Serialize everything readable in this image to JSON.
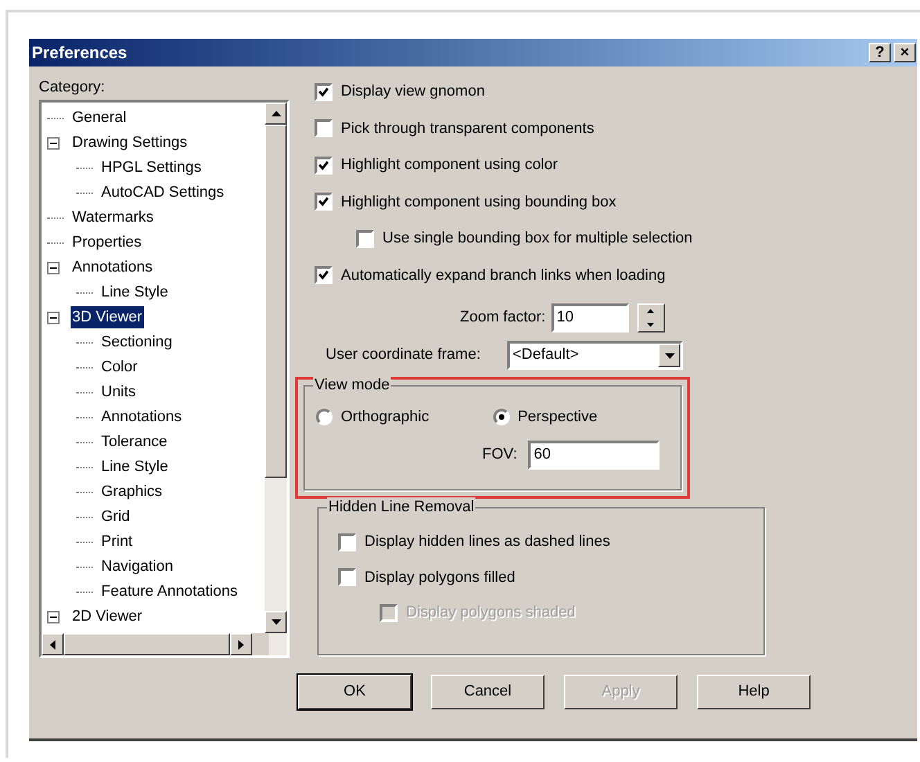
{
  "window": {
    "title": "Preferences",
    "buttons": [
      "?",
      "×"
    ]
  },
  "category": {
    "label": "Category:",
    "tree": [
      {
        "label": "General",
        "selected": false
      },
      {
        "label": "Drawing Settings",
        "selected": false,
        "expanded": true,
        "children": [
          {
            "label": "HPGL Settings",
            "selected": false
          },
          {
            "label": "AutoCAD Settings",
            "selected": false
          }
        ]
      },
      {
        "label": "Watermarks",
        "selected": false
      },
      {
        "label": "Properties",
        "selected": false
      },
      {
        "label": "Annotations",
        "selected": false,
        "expanded": true,
        "children": [
          {
            "label": "Line Style",
            "selected": false
          }
        ]
      },
      {
        "label": "3D Viewer",
        "selected": true,
        "expanded": true,
        "children": [
          {
            "label": "Sectioning",
            "selected": false
          },
          {
            "label": "Color",
            "selected": false
          },
          {
            "label": "Units",
            "selected": false
          },
          {
            "label": "Annotations",
            "selected": false
          },
          {
            "label": "Tolerance",
            "selected": false
          },
          {
            "label": "Line Style",
            "selected": false
          },
          {
            "label": "Graphics",
            "selected": false
          },
          {
            "label": "Grid",
            "selected": false
          },
          {
            "label": "Print",
            "selected": false
          },
          {
            "label": "Navigation",
            "selected": false
          },
          {
            "label": "Feature Annotations",
            "selected": false
          }
        ]
      },
      {
        "label": "2D Viewer",
        "selected": false,
        "expanded": true
      }
    ]
  },
  "options": [
    {
      "label": "Display view gnomon",
      "checked": true,
      "indented": false
    },
    {
      "label": "Pick through transparent components",
      "checked": false,
      "indented": false
    },
    {
      "label": "Highlight component using color",
      "checked": true,
      "indented": false
    },
    {
      "label": "Highlight component using bounding box",
      "checked": true,
      "indented": false
    },
    {
      "label": "Use single bounding box for multiple selection",
      "checked": false,
      "indented": true
    },
    {
      "label": "Automatically expand branch links when loading",
      "checked": true,
      "indented": false
    }
  ],
  "zoom_factor": {
    "label": "Zoom factor:",
    "value": "10"
  },
  "user_coordinate_frame": {
    "label": "User coordinate frame:",
    "value": "<Default>"
  },
  "view_mode": {
    "title": "View mode",
    "highlighted": true,
    "modes": [
      {
        "label": "Orthographic",
        "selected": false
      },
      {
        "label": "Perspective",
        "selected": true
      }
    ],
    "fov": {
      "label": "FOV:",
      "value": "60"
    }
  },
  "hidden_line_removal": {
    "title": "Hidden Line Removal",
    "options": [
      {
        "label": "Display hidden lines as dashed lines",
        "checked": false,
        "disabled": false,
        "indented": false
      },
      {
        "label": "Display polygons filled",
        "checked": false,
        "disabled": false,
        "indented": false
      },
      {
        "label": "Display polygons shaded",
        "checked": false,
        "disabled": true,
        "indented": true
      }
    ]
  },
  "buttons": [
    {
      "label": "OK",
      "disabled": false,
      "default": true
    },
    {
      "label": "Cancel",
      "disabled": false,
      "default": false
    },
    {
      "label": "Apply",
      "disabled": true,
      "default": false
    },
    {
      "label": "Help",
      "disabled": false,
      "default": false
    }
  ]
}
